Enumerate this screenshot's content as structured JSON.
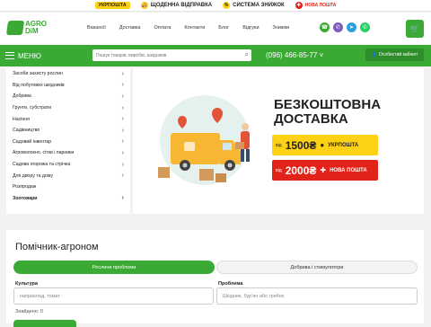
{
  "promo": {
    "ukrposhta": "УКРПОШТА",
    "daily": "ЩОДЕННА ВІДПРАВКА",
    "discount": "СИСТЕМА ЗНИЖОК",
    "nova": "НОВА ПОШТА"
  },
  "logo": {
    "line1": "AGRO",
    "line2": "DiM"
  },
  "nav": [
    "Вакансії",
    "Доставка",
    "Оплата",
    "Контакти",
    "Блог",
    "Відгуки",
    "Знижки"
  ],
  "menu_label": "МЕНЮ",
  "search": {
    "placeholder": "Пошук товарів, виробів, шкідників"
  },
  "phone": "(096) 466-85-77",
  "cabinet": "Особистий кабінет",
  "categories": [
    "Засоби захисту рослин",
    "Від побутових шкідників",
    "Добрива",
    "Грунти, субстрати",
    "Насіння",
    "Садівництво",
    "Садовий інвентар",
    "Агроволокно, сітки і парники",
    "Садова огорожа та стрічка",
    "Для двору та дому",
    "Розпродаж",
    "Зоотовари"
  ],
  "banner": {
    "title_line1": "БЕЗКОШТОВНА",
    "title_line2": "ДОСТАВКА",
    "ukr": {
      "from": "від",
      "sum": "1500₴",
      "brand": "УКРПОШТА"
    },
    "nova": {
      "from": "від",
      "sum": "2000₴",
      "brand": "НОВА ПОШТА"
    }
  },
  "agronom": {
    "title": "Помічник-агроном",
    "tab_active": "Рослини проблеми",
    "tab_inactive": "Добрива і стимулятори",
    "crop_label": "Культура",
    "crop_placeholder": "наприклад, томат",
    "problem_label": "Проблема",
    "problem_placeholder": "Шкідник, бур'ян або грибок",
    "found": "Знайдено: 0"
  },
  "colors": {
    "accent": "#3aaa35",
    "ukrposhta": "#fcd116",
    "novaposhta": "#e2231a"
  }
}
